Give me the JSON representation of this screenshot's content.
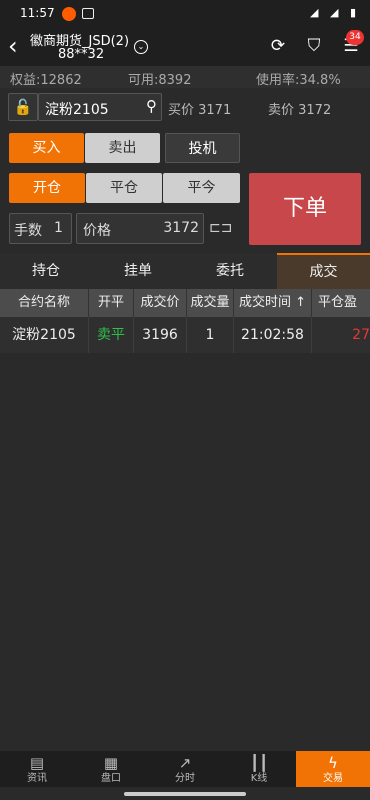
{
  "status": {
    "time": "11:57",
    "battery": "◢ ◢ ▮"
  },
  "header": {
    "title": "徽商期货_JSD(2)",
    "subtitle": "88**32",
    "notification_count": "34"
  },
  "account": {
    "equity": "权益:12862",
    "available": "可用:8392",
    "usage": "使用率:34.8%"
  },
  "contract": {
    "name": "淀粉2105",
    "bid": "买价 3171",
    "ask": "卖价 3172"
  },
  "order_panel": {
    "buy": "买入",
    "sell": "卖出",
    "speculation": "投机",
    "open": "开仓",
    "close": "平仓",
    "close_today": "平今",
    "qty_label": "手数",
    "qty_value": "1",
    "price_label": "价格",
    "price_value": "3172",
    "submit": "下单"
  },
  "tabs": [
    "持仓",
    "挂单",
    "委托",
    "成交"
  ],
  "table": {
    "headers": [
      "合约名称",
      "开平",
      "成交价",
      "成交量",
      "成交时间 ↑",
      "平仓盈"
    ],
    "rows": [
      {
        "contract": "淀粉2105",
        "open_close": "卖平",
        "price": "3196",
        "volume": "1",
        "time": "21:02:58",
        "pnl": "27"
      }
    ]
  },
  "nav": [
    {
      "label": "资讯",
      "icon": "news-icon"
    },
    {
      "label": "盘口",
      "icon": "orderbook-icon"
    },
    {
      "label": "分时",
      "icon": "timeshare-icon"
    },
    {
      "label": "K线",
      "icon": "kline-icon"
    },
    {
      "label": "交易",
      "icon": "trade-icon"
    }
  ],
  "colors": {
    "accent": "#f17306",
    "order_button": "#c8474a",
    "sell_close": "#2fbf4a",
    "profit": "#e53935"
  }
}
